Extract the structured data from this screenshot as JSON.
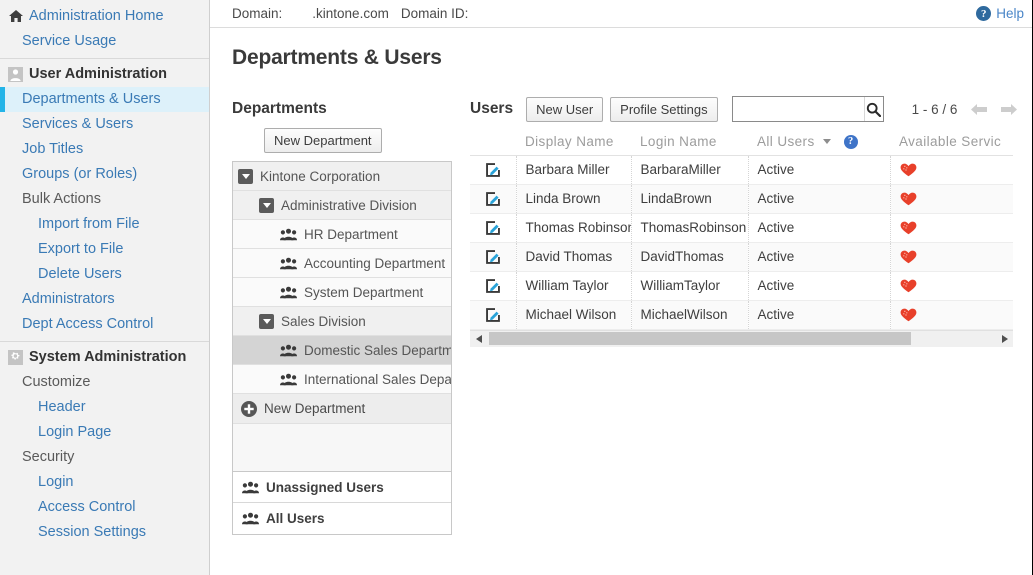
{
  "sidebar": {
    "groups": [
      {
        "items": [
          {
            "label": "Administration Home",
            "icon": "home-icon",
            "level": 0,
            "style": "link-bold-icon",
            "selected": false
          },
          {
            "label": "Service Usage",
            "icon": null,
            "level": 1,
            "style": "link",
            "selected": false
          }
        ]
      },
      {
        "items": [
          {
            "label": "User Administration",
            "icon": "user-icon",
            "level": 0,
            "style": "header",
            "selected": false
          },
          {
            "label": "Departments & Users",
            "icon": null,
            "level": 1,
            "style": "link",
            "selected": true
          },
          {
            "label": "Services & Users",
            "icon": null,
            "level": 1,
            "style": "link",
            "selected": false
          },
          {
            "label": "Job Titles",
            "icon": null,
            "level": 1,
            "style": "link",
            "selected": false
          },
          {
            "label": "Groups (or Roles)",
            "icon": null,
            "level": 1,
            "style": "link",
            "selected": false
          },
          {
            "label": "Bulk Actions",
            "icon": null,
            "level": 1,
            "style": "plain",
            "selected": false
          },
          {
            "label": "Import from File",
            "icon": null,
            "level": 2,
            "style": "link",
            "selected": false
          },
          {
            "label": "Export to File",
            "icon": null,
            "level": 2,
            "style": "link",
            "selected": false
          },
          {
            "label": "Delete Users",
            "icon": null,
            "level": 2,
            "style": "link",
            "selected": false
          },
          {
            "label": "Administrators",
            "icon": null,
            "level": 1,
            "style": "link",
            "selected": false
          },
          {
            "label": "Dept Access Control",
            "icon": null,
            "level": 1,
            "style": "link",
            "selected": false
          }
        ]
      },
      {
        "items": [
          {
            "label": "System Administration",
            "icon": "gear-icon",
            "level": 0,
            "style": "header",
            "selected": false
          },
          {
            "label": "Customize",
            "icon": null,
            "level": 1,
            "style": "plain",
            "selected": false
          },
          {
            "label": "Header",
            "icon": null,
            "level": 2,
            "style": "link",
            "selected": false
          },
          {
            "label": "Login Page",
            "icon": null,
            "level": 2,
            "style": "link",
            "selected": false
          },
          {
            "label": "Security",
            "icon": null,
            "level": 1,
            "style": "plain",
            "selected": false
          },
          {
            "label": "Login",
            "icon": null,
            "level": 2,
            "style": "link",
            "selected": false
          },
          {
            "label": "Access Control",
            "icon": null,
            "level": 2,
            "style": "link",
            "selected": false
          },
          {
            "label": "Session Settings",
            "icon": null,
            "level": 2,
            "style": "link",
            "selected": false
          }
        ]
      }
    ]
  },
  "topbar": {
    "domain_label": "Domain:",
    "domain_value": ".kintone.com",
    "domain_id_label": "Domain ID:",
    "domain_id_value": "",
    "help_label": "Help",
    "help_glyph": "?"
  },
  "page": {
    "title": "Departments & Users"
  },
  "departments": {
    "title": "Departments",
    "new_button": "New Department",
    "tree": [
      {
        "label": "Kintone Corporation",
        "level": 1,
        "icon": "collapse-toggle-icon",
        "selected": false
      },
      {
        "label": "Administrative Division",
        "level": 2,
        "icon": "collapse-toggle-icon",
        "selected": false
      },
      {
        "label": "HR Department",
        "level": 3,
        "icon": "people-icon",
        "selected": false
      },
      {
        "label": "Accounting Department",
        "level": 3,
        "icon": "people-icon",
        "selected": false
      },
      {
        "label": "System Department",
        "level": 3,
        "icon": "people-icon",
        "selected": false
      },
      {
        "label": "Sales Division",
        "level": 2,
        "icon": "collapse-toggle-icon",
        "selected": false
      },
      {
        "label": "Domestic Sales Department",
        "level": 3,
        "icon": "people-icon",
        "selected": true
      },
      {
        "label": "International Sales Department",
        "level": 3,
        "icon": "people-icon",
        "selected": false
      }
    ],
    "new_department_row": "New Department",
    "footer": [
      {
        "label": "Unassigned Users",
        "icon": "people-icon"
      },
      {
        "label": "All Users",
        "icon": "people-icon"
      }
    ]
  },
  "users": {
    "title": "Users",
    "new_user_button": "New User",
    "profile_settings_button": "Profile Settings",
    "search_value": "",
    "search_placeholder": "",
    "pager_text": "1 - 6 / 6",
    "columns": [
      {
        "key": "edit",
        "label": ""
      },
      {
        "key": "display_name",
        "label": "Display Name"
      },
      {
        "key": "login_name",
        "label": "Login Name"
      },
      {
        "key": "status",
        "label": "All Users",
        "has_dropdown": true,
        "has_help": true
      },
      {
        "key": "available_service",
        "label": "Available Servic"
      }
    ],
    "rows": [
      {
        "display_name": "Barbara Miller",
        "login_name": "BarbaraMiller",
        "status": "Active",
        "service": "heart-icon"
      },
      {
        "display_name": "Linda Brown",
        "login_name": "LindaBrown",
        "status": "Active",
        "service": "heart-icon"
      },
      {
        "display_name": "Thomas Robinson",
        "login_name": "ThomasRobinson",
        "status": "Active",
        "service": "heart-icon"
      },
      {
        "display_name": "David Thomas",
        "login_name": "DavidThomas",
        "status": "Active",
        "service": "heart-icon"
      },
      {
        "display_name": "William Taylor",
        "login_name": "WilliamTaylor",
        "status": "Active",
        "service": "heart-icon"
      },
      {
        "display_name": "Michael Wilson",
        "login_name": "MichaelWilson",
        "status": "Active",
        "service": "heart-icon"
      }
    ],
    "help_glyph": "?"
  },
  "colors": {
    "accent": "#23b4e8",
    "link": "#3a7ab5",
    "selected_bg": "#ddf1fa",
    "heart": "#e8402a",
    "pencil": "#29a3d9",
    "help_badge": "#2f6a9e"
  }
}
